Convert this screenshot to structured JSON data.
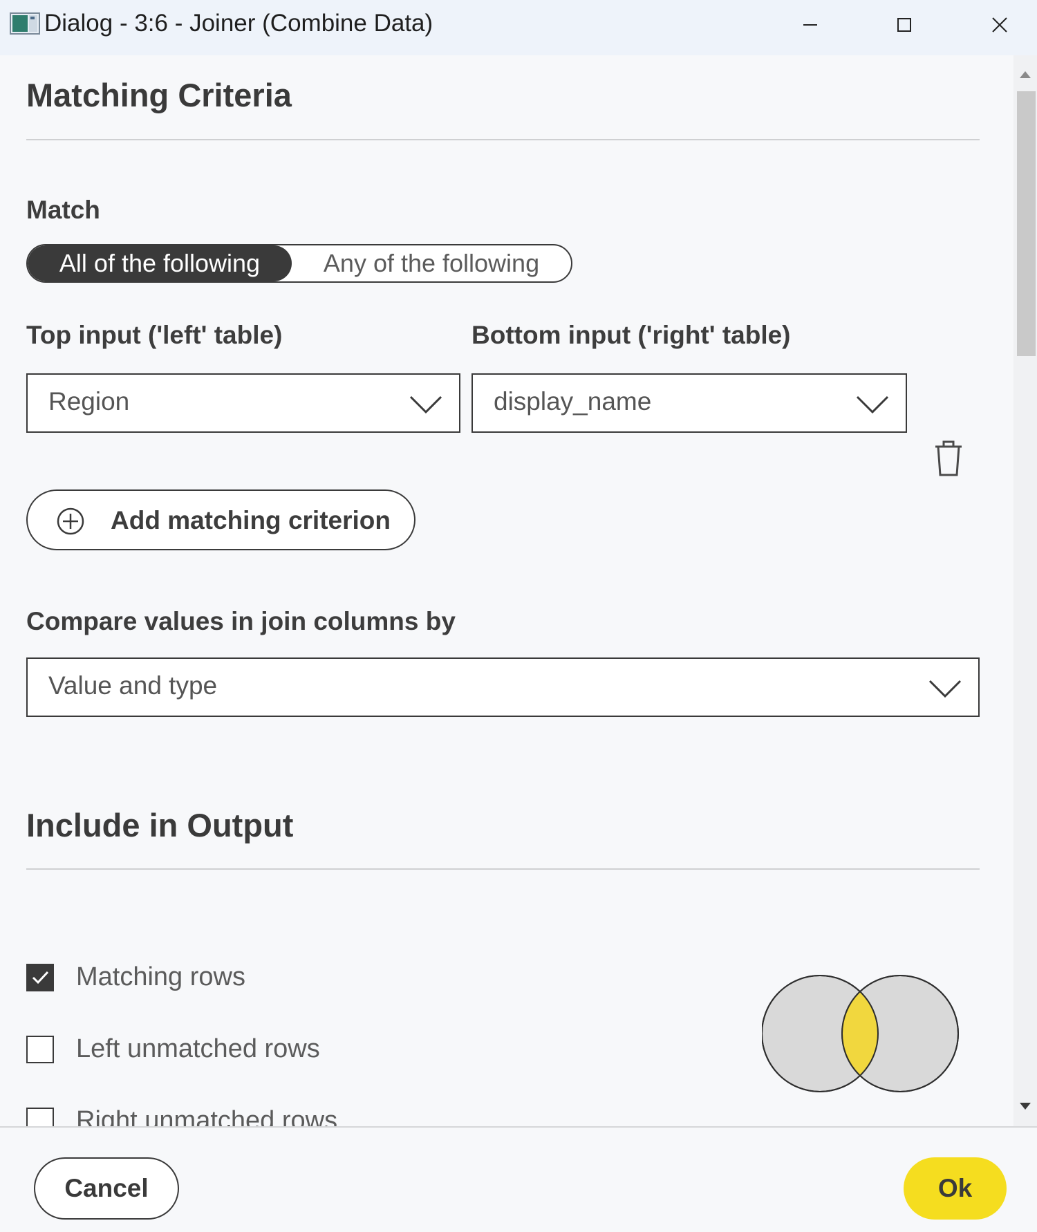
{
  "window": {
    "title": "Dialog - 3:6 - Joiner (Combine Data)",
    "controls": [
      "minimize-icon",
      "maximize-icon",
      "close-icon"
    ]
  },
  "matching": {
    "section_title": "Matching Criteria",
    "match_label": "Match",
    "match_options": [
      "All of the following",
      "Any of the following"
    ],
    "match_selected": "All of the following",
    "left_label": "Top input ('left' table)",
    "right_label": "Bottom input ('right' table)",
    "left_value": "Region",
    "right_value": "display_name",
    "add_button": "Add matching criterion",
    "compare_label": "Compare values in join columns by",
    "compare_value": "Value and type"
  },
  "output": {
    "section_title": "Include in Output",
    "options": [
      {
        "label": "Matching rows",
        "checked": true
      },
      {
        "label": "Left unmatched rows",
        "checked": false
      },
      {
        "label": "Right unmatched rows",
        "checked": false
      }
    ]
  },
  "footer": {
    "cancel": "Cancel",
    "ok": "Ok"
  },
  "colors": {
    "accent": "#f5dd1f",
    "dark": "#3a3a3a",
    "venn_circle": "#d9d9d9",
    "venn_intersection": "#f1d73e"
  },
  "icons": {
    "trash": "trash-icon",
    "add": "plus-circle-icon",
    "dropdown": "chevron-down-icon",
    "check": "checkmark-icon"
  }
}
